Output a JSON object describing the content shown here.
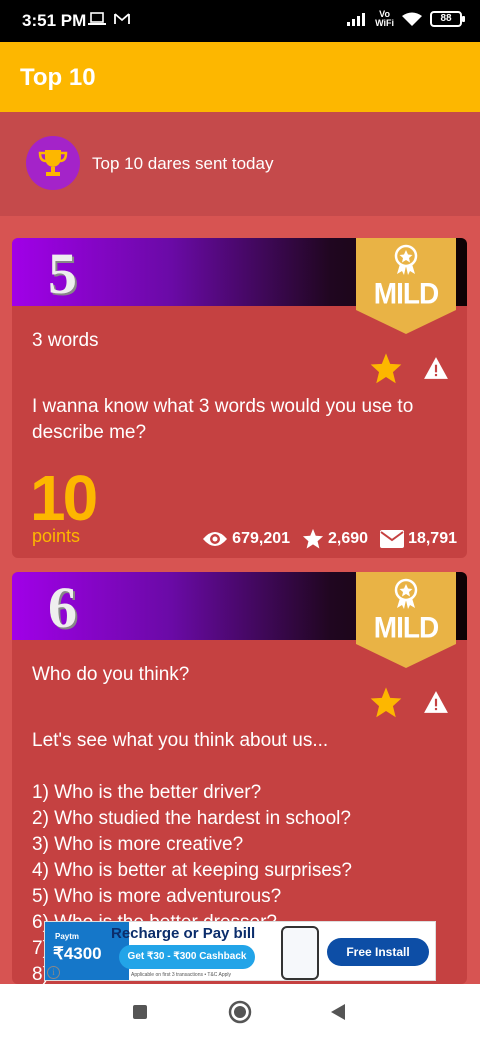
{
  "status": {
    "time": "3:51 PM",
    "volte_top": "Vo",
    "volte_bottom": "WiFi",
    "battery": "88"
  },
  "appbar": {
    "title": "Top 10"
  },
  "banner": {
    "text": "Top 10 dares sent today",
    "icon": "trophy-icon"
  },
  "cards": [
    {
      "rank": "5",
      "level": "MILD",
      "title": "3 words",
      "body": "I wanna know what 3 words would you use to describe me?",
      "points": "10",
      "points_label": "points",
      "views": "679,201",
      "stars": "2,690",
      "messages": "18,791"
    },
    {
      "rank": "6",
      "level": "MILD",
      "title": "Who do you think?",
      "body": "Let's see what you think about us...\n\n1) Who is the better driver?\n2) Who studied the hardest in school?\n3) Who is more creative?\n4) Who is better at keeping surprises?\n5) Who is more adventurous?\n6) Who is the better dresser?\n7)\n8)"
    }
  ],
  "ad": {
    "brand": "Paytm",
    "amount": "₹4300",
    "title": "Recharge or Pay bill",
    "cashback": "Get ₹30 - ₹300 Cashback",
    "terms": "Applicable on first 3 transactions • T&C Apply",
    "button": "Free Install",
    "info": "i"
  },
  "colors": {
    "background": "#d75452",
    "appbar": "#fdb700",
    "card": "#c54141",
    "accent": "#fdb700",
    "badge": "#e9b345"
  }
}
